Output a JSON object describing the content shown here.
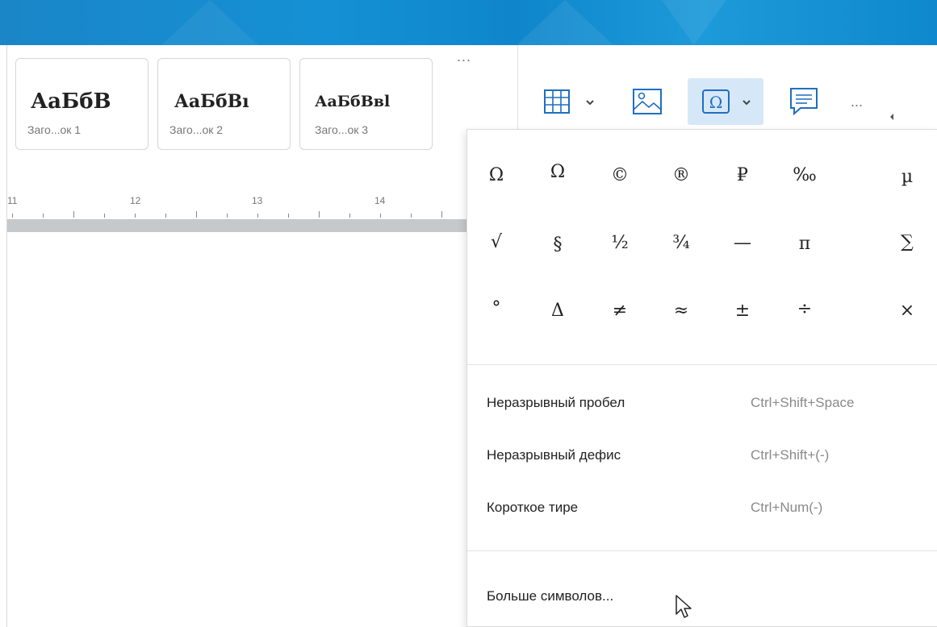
{
  "styles": {
    "cards": [
      {
        "sample": "АаБбВ",
        "name": "Заго...ок 1"
      },
      {
        "sample": "АаБбВı",
        "name": "Заго...ок 2"
      },
      {
        "sample": "АаБбВвl",
        "name": "Заго...ок 3"
      }
    ],
    "more": "..."
  },
  "toolbar": {
    "more": "...",
    "icons": [
      "table-icon",
      "image-icon",
      "omega-icon",
      "comment-icon"
    ]
  },
  "ruler": {
    "numbers": [
      "11",
      "12",
      "13",
      "14"
    ]
  },
  "symbols": {
    "row1": [
      "Ω",
      "Ω",
      "©",
      "®",
      "₽",
      "‰",
      "µ"
    ],
    "row2": [
      "√",
      "§",
      "½",
      "¾",
      "—",
      "π",
      "∑"
    ],
    "row3": [
      "°",
      "Δ",
      "≠",
      "≈",
      "±",
      "÷",
      "×"
    ]
  },
  "menu": {
    "items": [
      {
        "label": "Неразрывный пробел",
        "shortcut": "Ctrl+Shift+Space"
      },
      {
        "label": "Неразрывный дефис",
        "shortcut": "Ctrl+Shift+(-)"
      },
      {
        "label": "Короткое тире",
        "shortcut": "Ctrl+Num(-)"
      }
    ],
    "more_symbols": "Больше символов..."
  },
  "colors": {
    "titlebar": "#1590d4",
    "accent": "#1e6fc0",
    "active_bg": "#d6e8f7"
  }
}
